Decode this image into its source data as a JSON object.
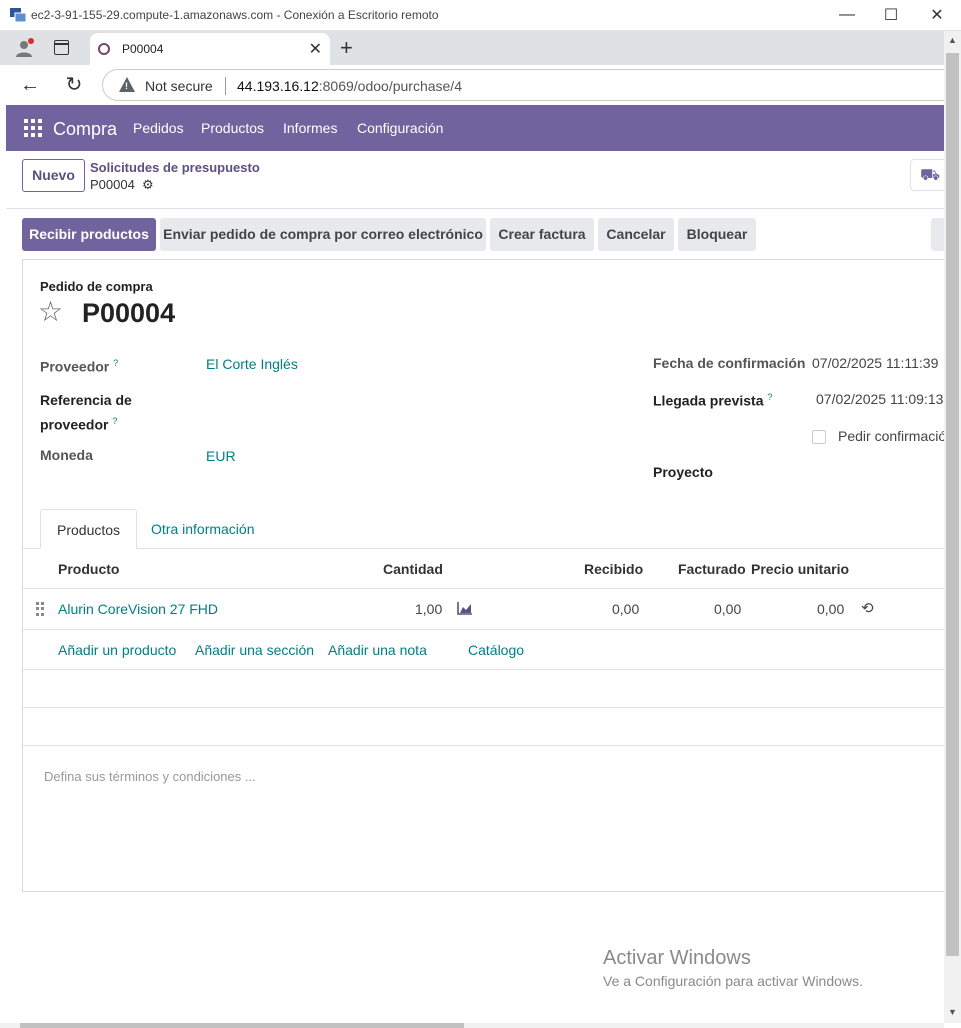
{
  "window": {
    "title": "ec2-3-91-155-29.compute-1.amazonaws.com - Conexión a Escritorio remoto",
    "minimize_icon": "minimize-icon",
    "maximize_icon": "maximize-icon",
    "close_icon": "close-icon"
  },
  "browser": {
    "tab_title": "P00004",
    "address_warning": "Not secure",
    "url_host": "44.193.16.12",
    "url_rest": ":8069/odoo/purchase/4"
  },
  "navbar": {
    "app_name": "Compra",
    "menu": [
      "Pedidos",
      "Productos",
      "Informes",
      "Configuración"
    ],
    "color": "#71639e"
  },
  "control_panel": {
    "new_button": "Nuevo",
    "breadcrumb_parent": "Solicitudes de presupuesto",
    "breadcrumb_current": "P00004"
  },
  "status_buttons": {
    "receive": "Recibir productos",
    "send_email": "Enviar pedido de compra por correo electrónico",
    "create_invoice": "Crear factura",
    "cancel": "Cancelar",
    "lock": "Bloquear"
  },
  "form": {
    "kind": "Pedido de compra",
    "name": "P00004",
    "fields": {
      "vendor_label": "Proveedor",
      "vendor_value": "El Corte Inglés",
      "vendor_ref_label_1": "Referencia de",
      "vendor_ref_label_2": "proveedor",
      "currency_label": "Moneda",
      "currency_value": "EUR",
      "confirm_date_label": "Fecha de confirmación",
      "confirm_date_value": "07/02/2025 11:11:39",
      "expected_arrival_label": "Llegada prevista",
      "expected_arrival_value": "07/02/2025 11:09:13",
      "ask_confirmation_label": "Pedir confirmació",
      "project_label": "Proyecto",
      "help_mark": "?"
    }
  },
  "notebook": {
    "tabs": [
      "Productos",
      "Otra información"
    ]
  },
  "lines": {
    "headers": {
      "product": "Producto",
      "quantity": "Cantidad",
      "received": "Recibido",
      "invoiced": "Facturado",
      "unit_price": "Precio unitario"
    },
    "rows": [
      {
        "product": "Alurin CoreVision 27 FHD",
        "quantity": "1,00",
        "received": "0,00",
        "invoiced": "0,00",
        "unit_price": "0,00"
      }
    ],
    "add_links": {
      "product": "Añadir un producto",
      "section": "Añadir una sección",
      "note": "Añadir una nota",
      "catalog": "Catálogo"
    }
  },
  "terms_placeholder": "Defina sus términos y condiciones ...",
  "watermark": {
    "line1": "Activar Windows",
    "line2": "Ve a Configuración para activar Windows."
  }
}
